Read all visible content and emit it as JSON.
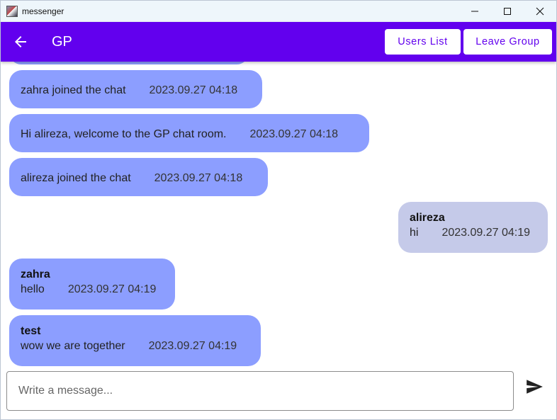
{
  "window": {
    "title": "messenger",
    "controls": [
      "minimize-icon",
      "maximize-icon",
      "close-icon"
    ]
  },
  "appbar": {
    "title": "GP",
    "back_icon": "arrow-back-icon",
    "users_list_label": "Users List",
    "leave_group_label": "Leave Group",
    "color": "#6200ee"
  },
  "messages": [
    {
      "text": "zahra joined the chat",
      "time": "2023.09.27 04:18"
    },
    {
      "text": "Hi alireza, welcome to the GP chat room.",
      "time": "2023.09.27 04:18"
    },
    {
      "text": "alireza joined the chat",
      "time": "2023.09.27 04:18"
    },
    {
      "sender": "alireza",
      "text": "hi",
      "time": "2023.09.27 04:19",
      "mine": true
    },
    {
      "sender": "zahra",
      "text": "hello",
      "time": "2023.09.27 04:19"
    },
    {
      "sender": "test",
      "text": "wow we are together",
      "time": "2023.09.27 04:19"
    }
  ],
  "composer": {
    "placeholder": "Write a message...",
    "value": "",
    "send_icon": "send-icon"
  },
  "colors": {
    "bubble_others": "#8c9eff",
    "bubble_mine": "#c5cae9"
  }
}
